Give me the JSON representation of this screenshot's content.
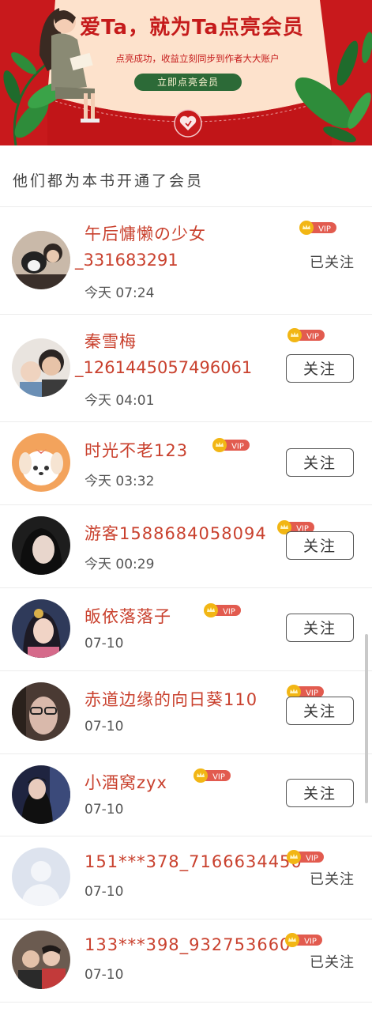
{
  "banner": {
    "title": "爱Ta，就为Ta点亮会员",
    "subtitle": "点亮成功，收益立刻同步到作者大大账户",
    "button_label": "立即点亮会员"
  },
  "section_title": "他们都为本书开通了会员",
  "vip_badge": "VIP",
  "members": [
    {
      "name": "午后慵懒の少女",
      "name_cont": "_331683291",
      "time": "今天 07:24",
      "status": "已关注"
    },
    {
      "name": "秦雪梅",
      "name_cont": "_1261445057496061",
      "time": "今天 04:01",
      "status": "关注"
    },
    {
      "name": "时光不老123",
      "time": "今天 03:32",
      "status": "关注"
    },
    {
      "name": "游客1588684058094",
      "time": "今天 00:29",
      "status": "关注"
    },
    {
      "name": "皈依落落子",
      "time": "07-10",
      "status": "关注"
    },
    {
      "name": "赤道边缘的向日葵110",
      "time": "07-10",
      "status": "关注"
    },
    {
      "name": "小酒窝zyx",
      "time": "07-10",
      "status": "关注"
    },
    {
      "name": "151***378_7166634450",
      "time": "07-10",
      "status": "已关注"
    },
    {
      "name": "133***398_932753660",
      "time": "07-10",
      "status": "已关注"
    }
  ],
  "colors": {
    "banner_red": "#c0171a",
    "name_red": "#c9412e",
    "vip_gold": "#f2b614",
    "vip_red": "#e25b4f",
    "button_green": "#2c6a37"
  }
}
